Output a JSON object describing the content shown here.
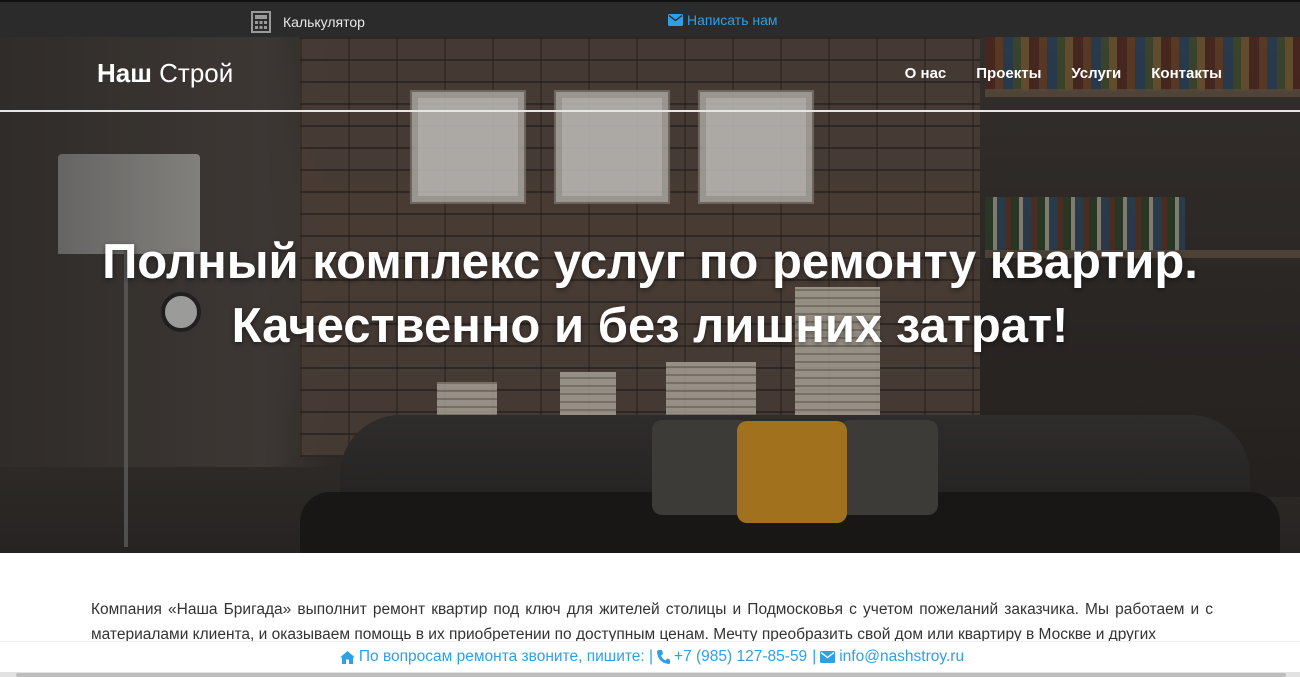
{
  "topbar": {
    "calculator_label": "Калькулятор",
    "write_label": "Написать нам"
  },
  "header": {
    "brand_bold": "Наш",
    "brand_rest": "Строй",
    "nav": [
      {
        "label": "О нас"
      },
      {
        "label": "Проекты"
      },
      {
        "label": "Услуги"
      },
      {
        "label": "Контакты"
      }
    ]
  },
  "hero": {
    "line1": "Полный комплекс услуг по ремонту квартир.",
    "line2": "Качественно и без лишних затрат!"
  },
  "content": {
    "intro": "Компания «Наша Бригада» выполнит ремонт квартир под ключ для жителей столицы и Подмосковья с учетом пожеланий заказчика. Мы работаем и с материалами клиента, и оказываем помощь в их приобретении по доступным ценам. Мечту преобразить свой дом или квартиру в Москве и других"
  },
  "bottombar": {
    "prompt": "По вопросам ремонта звоните, пишите: |",
    "phone": "+7 (985) 127-85-59",
    "separator": "|",
    "email": "info@nashstroy.ru"
  },
  "colors": {
    "accent": "#2ea0e6",
    "topbar_bg": "#2b2b2b",
    "text": "#333333"
  }
}
